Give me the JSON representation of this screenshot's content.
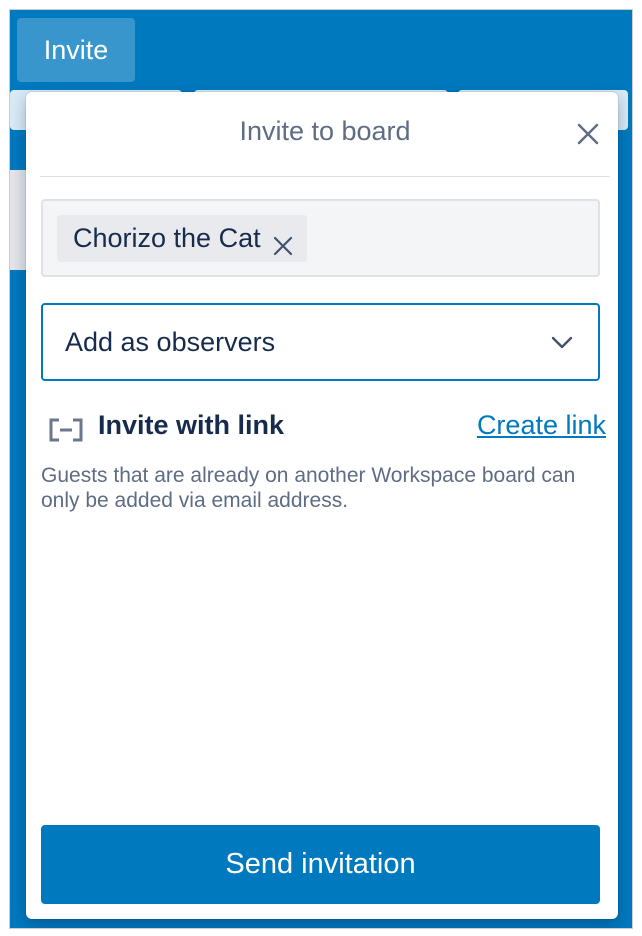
{
  "header": {
    "invite_label": "Invite"
  },
  "popover": {
    "title": "Invite to board",
    "close_icon": "close-icon",
    "invitees": [
      {
        "name": "Chorizo the Cat",
        "remove_icon": "close-icon"
      }
    ],
    "role_select": {
      "selected": "Add as observers",
      "icon": "chevron-down-icon"
    },
    "invite_link": {
      "icon": "link-icon",
      "heading": "Invite with link",
      "action_label": "Create link"
    },
    "help_text": "Guests that are already on another Workspace board can only be added via email address.",
    "submit_label": "Send invitation"
  },
  "colors": {
    "board_background": "#0079bf",
    "primary": "#0079bf",
    "text_primary": "#172b4d",
    "text_secondary": "#5e6c84"
  }
}
